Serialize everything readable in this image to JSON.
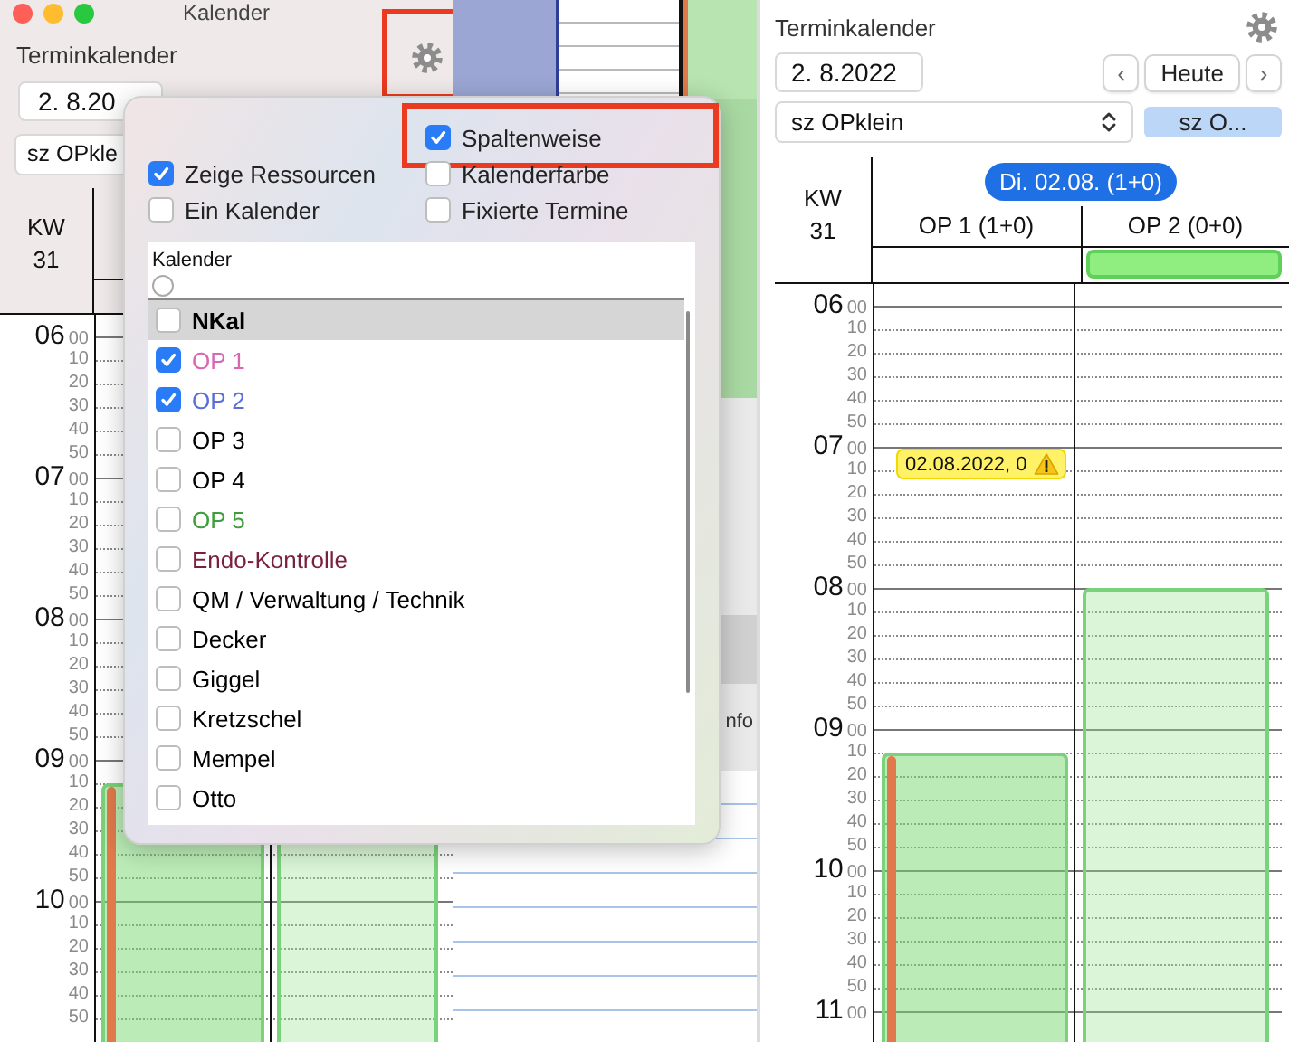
{
  "left_window": {
    "title": "Kalender",
    "heading": "Terminkalender",
    "gear_highlighted": true,
    "date": "2. 8.20",
    "selector": "sz OPkle",
    "week_label": "KW",
    "week_number": "31",
    "hours": [
      {
        "hour": "06",
        "minutes": [
          "00",
          "10",
          "20",
          "30",
          "40",
          "50"
        ]
      },
      {
        "hour": "07",
        "minutes": [
          "00",
          "10",
          "20",
          "30",
          "40",
          "50"
        ]
      },
      {
        "hour": "08",
        "minutes": [
          "00",
          "10",
          "20",
          "30",
          "40",
          "50"
        ]
      },
      {
        "hour": "09",
        "minutes": [
          "00",
          "10",
          "20",
          "30",
          "40",
          "50"
        ]
      },
      {
        "hour": "10",
        "minutes": [
          "00",
          "10",
          "20",
          "30",
          "40",
          "50"
        ]
      }
    ]
  },
  "background_window": {
    "label": "nfo"
  },
  "popover": {
    "options": [
      {
        "label": "Spaltenweise",
        "checked": true,
        "highlighted": true
      },
      {
        "label": "Zeige Ressourcen",
        "checked": true,
        "highlighted": false
      },
      {
        "label": "Kalenderfarbe",
        "checked": false,
        "highlighted": false
      },
      {
        "label": "Ein Kalender",
        "checked": false,
        "highlighted": false
      },
      {
        "label": "Fixierte Termine",
        "checked": false,
        "highlighted": false
      }
    ],
    "list_header": "Kalender",
    "list_radio_selected": false,
    "calendars": [
      {
        "label": "NKal",
        "checked": false,
        "selected": true,
        "color": "#000000"
      },
      {
        "label": "OP 1",
        "checked": true,
        "selected": false,
        "color": "#d966b0"
      },
      {
        "label": "OP 2",
        "checked": true,
        "selected": false,
        "color": "#5a6fd6"
      },
      {
        "label": "OP 3",
        "checked": false,
        "selected": false,
        "color": "#000000"
      },
      {
        "label": "OP 4",
        "checked": false,
        "selected": false,
        "color": "#000000"
      },
      {
        "label": "OP 5",
        "checked": false,
        "selected": false,
        "color": "#3f9e3a"
      },
      {
        "label": "Endo-Kontrolle",
        "checked": false,
        "selected": false,
        "color": "#7a1f3c"
      },
      {
        "label": "QM / Verwaltung / Technik",
        "checked": false,
        "selected": false,
        "color": "#000000"
      },
      {
        "label": "Decker",
        "checked": false,
        "selected": false,
        "color": "#000000"
      },
      {
        "label": "Giggel",
        "checked": false,
        "selected": false,
        "color": "#000000"
      },
      {
        "label": "Kretzschel",
        "checked": false,
        "selected": false,
        "color": "#000000"
      },
      {
        "label": "Mempel",
        "checked": false,
        "selected": false,
        "color": "#000000"
      },
      {
        "label": "Otto",
        "checked": false,
        "selected": false,
        "color": "#000000"
      }
    ]
  },
  "right_panel": {
    "heading": "Terminkalender",
    "date": "2.  8.2022",
    "prev": "‹",
    "today": "Heute",
    "next": "›",
    "selector": "sz OPklein",
    "chip": "sz O...",
    "week_label": "KW",
    "week_number": "31",
    "day": "Di. 02.08. (1+0)",
    "columns": [
      "OP 1 (1+0)",
      "OP 2 (0+0)"
    ],
    "appointment": {
      "text": "02.08.2022, 0",
      "warning": true
    },
    "hours": [
      {
        "hour": "06",
        "minutes": [
          "00",
          "10",
          "20",
          "30",
          "40",
          "50"
        ]
      },
      {
        "hour": "07",
        "minutes": [
          "00",
          "10",
          "20",
          "30",
          "40",
          "50"
        ]
      },
      {
        "hour": "08",
        "minutes": [
          "00",
          "10",
          "20",
          "30",
          "40",
          "50"
        ]
      },
      {
        "hour": "09",
        "minutes": [
          "00",
          "10",
          "20",
          "30",
          "40",
          "50"
        ]
      },
      {
        "hour": "10",
        "minutes": [
          "00",
          "10",
          "20",
          "30",
          "40",
          "50"
        ]
      },
      {
        "hour": "11",
        "minutes": [
          "00"
        ]
      }
    ]
  }
}
